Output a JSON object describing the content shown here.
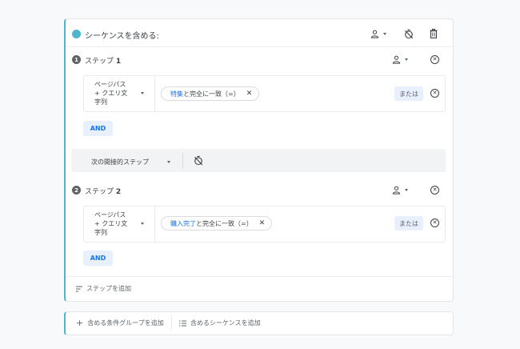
{
  "sequence": {
    "title": "シーケンスを含める:"
  },
  "steps": [
    {
      "number": "1",
      "label": "ステップ",
      "label_num": "1",
      "dimension_line1": "ページパス",
      "dimension_line2": "+ クエリ文",
      "dimension_line3": "字列",
      "chip_value": "特集",
      "chip_condition": " と完全に一致（=）",
      "or_label": "または",
      "and_label": "AND"
    },
    {
      "number": "2",
      "label": "ステップ",
      "label_num": "2",
      "dimension_line1": "ページパス",
      "dimension_line2": "+ クエリ文",
      "dimension_line3": "字列",
      "chip_value": "購入完了",
      "chip_condition": " と完全に一致（=）",
      "or_label": "または",
      "and_label": "AND"
    }
  ],
  "next_step": {
    "label": "次の間接的ステップ"
  },
  "add_step": {
    "label": "ステップを追加"
  },
  "bottom": {
    "add_group": "含める条件グループを追加",
    "add_sequence": "含めるシーケンスを追加"
  },
  "colors": {
    "accent": "#4db6c8",
    "chip_bg": "#e8f0fe",
    "link_blue": "#1a73e8"
  }
}
